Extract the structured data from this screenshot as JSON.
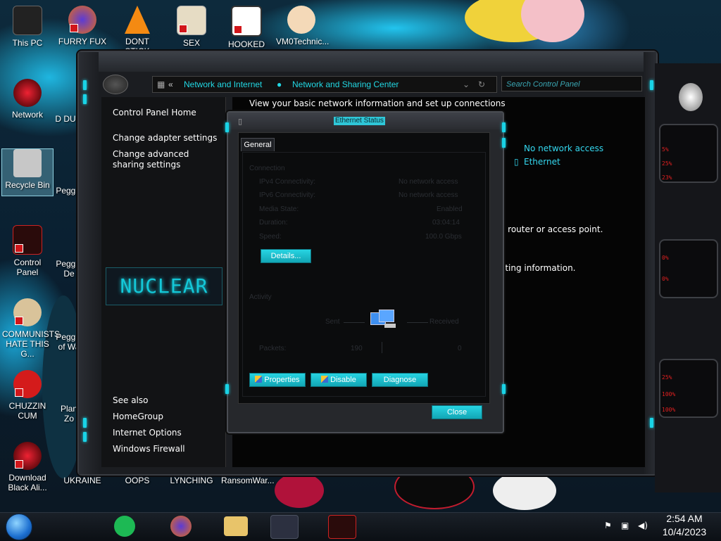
{
  "desktop": {
    "icons": [
      {
        "label": "This PC"
      },
      {
        "label": "FURRY FUX"
      },
      {
        "label": "DONT STICK"
      },
      {
        "label": "SEX EDITOR"
      },
      {
        "label": "HOOKED ON"
      },
      {
        "label": "VM0Technic..."
      },
      {
        "label": "Network"
      },
      {
        "label": "Recycle Bin"
      },
      {
        "label": "Control Panel"
      },
      {
        "label": "COMMUNISTS HATE THIS G..."
      },
      {
        "label": "CHUZZIN CUM"
      },
      {
        "label": "Download Black Ali..."
      },
      {
        "label": "UKRAINE"
      },
      {
        "label": "OOPS"
      },
      {
        "label": "LYNCHING"
      },
      {
        "label": "RansomWar..."
      },
      {
        "label": "D DUM"
      },
      {
        "label": "Peggle"
      },
      {
        "label": "Peggle De"
      },
      {
        "label": "Peggle of Wa"
      },
      {
        "label": "Plan Zo"
      }
    ]
  },
  "window": {
    "address": {
      "crumb1": "Network and Internet",
      "crumb2": "Network and Sharing Center",
      "prefix": "«"
    },
    "search_placeholder": "Search Control Panel",
    "left_pane": {
      "home": "Control Panel Home",
      "links": [
        "Change adapter settings",
        "Change advanced sharing settings"
      ],
      "see_also_title": "See also",
      "see_also": [
        "HomeGroup",
        "Internet Options",
        "Windows Firewall"
      ],
      "logo": "NUCLEAR"
    },
    "main": {
      "heading": "View your basic network information and set up connections",
      "access": "No network access",
      "connection": "Ethernet",
      "partial1": "a router or access point.",
      "partial2": "oting information.",
      "colon": ":"
    }
  },
  "dialog": {
    "title": "Ethernet Status",
    "tab": "General",
    "connection_section": "Connection",
    "rows": [
      {
        "label": "IPv4 Connectivity:",
        "value": "No network access"
      },
      {
        "label": "IPv6 Connectivity:",
        "value": "No network access"
      },
      {
        "label": "Media State:",
        "value": "Enabled"
      },
      {
        "label": "Duration:",
        "value": "03:04:14"
      },
      {
        "label": "Speed:",
        "value": "100.0 Gbps"
      }
    ],
    "details_button": "Details...",
    "activity_section": "Activity",
    "sent_label": "Sent",
    "received_label": "Received",
    "packets_label": "Packets:",
    "packets_sent": "190",
    "packets_received": "0",
    "properties_button": "Properties",
    "disable_button": "Disable",
    "diagnose_button": "Diagnose",
    "close_button": "Close"
  },
  "widget": {
    "values": [
      "5%",
      "25%",
      "23%",
      "0%",
      "0%",
      "25%",
      "100%",
      "100%"
    ]
  },
  "taskbar": {
    "time": "2:54 AM",
    "date": "10/4/2023"
  }
}
